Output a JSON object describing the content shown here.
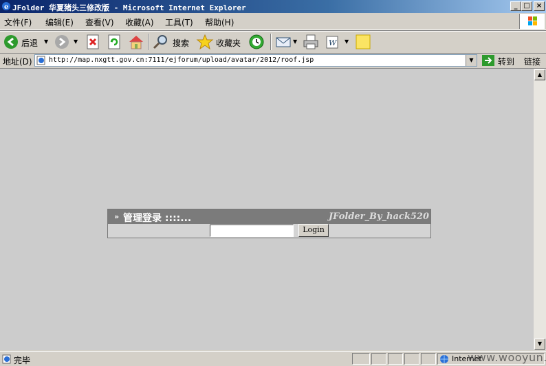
{
  "window": {
    "title": "JFolder 华夏猪头三修改版 - Microsoft Internet Explorer",
    "buttons": [
      "_",
      "□",
      "×"
    ]
  },
  "menu": [
    "文件(F)",
    "编辑(E)",
    "查看(V)",
    "收藏(A)",
    "工具(T)",
    "帮助(H)"
  ],
  "toolbar": {
    "back_label": "后退",
    "search_label": "搜索",
    "favorites_label": "收藏夹"
  },
  "address": {
    "label": "地址(D)",
    "url": "http://map.nxgtt.gov.cn:7111/ejforum/upload/avatar/2012/roof.jsp",
    "go_label": "转到",
    "links_label": "链接"
  },
  "panel": {
    "title": "管理登录 ::::...",
    "credit": "JFolder_By_hack520",
    "password_value": "",
    "login_button": "Login"
  },
  "status": {
    "text": "完毕",
    "zone": "Internet"
  },
  "watermark": "www.wooyun.org",
  "colors": {
    "titlebar": "#0a246a",
    "content_bg": "#cccccc",
    "panel_header": "#7b7b7b"
  }
}
